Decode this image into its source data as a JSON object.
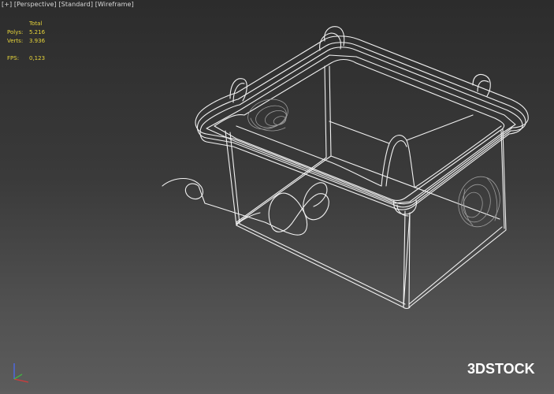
{
  "viewport_label": {
    "plus": "[+]",
    "view": "[Perspective]",
    "shading_standard": "[Standard]",
    "shading_mode": "[Wireframe]"
  },
  "stats": {
    "header": "Total",
    "polys_label": "Polys:",
    "polys_value": "5.216",
    "verts_label": "Verts:",
    "verts_value": "3.936",
    "fps_label": "FPS:",
    "fps_value": "0,123",
    "color": "#e6d43a"
  },
  "watermark": {
    "text_3d": "3D",
    "text_stock": "STOCK"
  },
  "axis_gizmo": {
    "x_color": "#d23a3a",
    "y_color": "#3ec23e",
    "z_color": "#4a6cff"
  },
  "wireframe_color": "#f2f2f2"
}
